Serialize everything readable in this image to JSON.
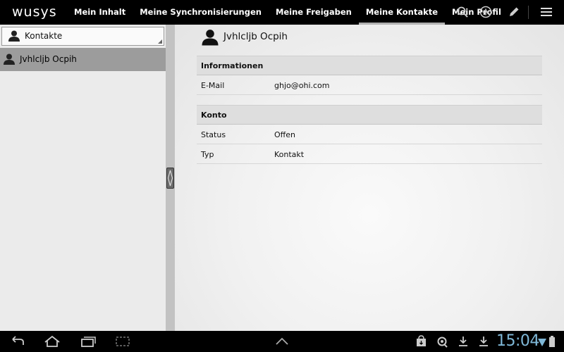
{
  "app": {
    "logo": "wusys"
  },
  "nav": {
    "tabs": [
      {
        "label": "Mein Inhalt"
      },
      {
        "label": "Meine Synchronisierungen"
      },
      {
        "label": "Meine Freigaben"
      },
      {
        "label": "Meine Kontakte",
        "active": true
      },
      {
        "label": "Mein Profil"
      }
    ],
    "actions": [
      "search-icon",
      "add-icon",
      "edit-icon",
      "overflow-menu-icon"
    ]
  },
  "sidebar": {
    "filter_label": "Kontakte",
    "items": [
      {
        "name": "Jvhlcljb Ocpih",
        "selected": true
      }
    ]
  },
  "detail": {
    "name": "Jvhlcljb Ocpih",
    "sections": [
      {
        "title": "Informationen",
        "rows": [
          {
            "key": "E-Mail",
            "value": "ghjo@ohi.com"
          }
        ]
      },
      {
        "title": "Konto",
        "rows": [
          {
            "key": "Status",
            "value": "Offen"
          },
          {
            "key": "Typ",
            "value": "Kontakt"
          }
        ]
      }
    ]
  },
  "system_bar": {
    "time": "15:04",
    "nav_icons": [
      "back-icon",
      "home-icon",
      "recent-apps-icon",
      "screenshot-icon",
      "up-arrow-icon"
    ],
    "status_icons": [
      "store-icon",
      "sync-icon",
      "download-icon",
      "download-icon",
      "wifi-icon",
      "battery-icon"
    ]
  },
  "colors": {
    "topbar": "#000000",
    "selected_item": "#9c9c9c",
    "clock": "#7fb8d8"
  }
}
